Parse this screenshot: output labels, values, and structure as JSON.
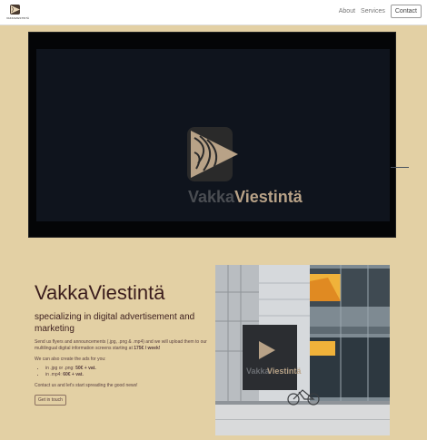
{
  "brand": {
    "tag": "VAKKAVIESTINTÄ"
  },
  "nav": {
    "about": "About",
    "services": "Services",
    "contact": "Contact"
  },
  "video": {
    "word_dark": "Vakka",
    "word_light": "Viestintä"
  },
  "hero": {
    "title": "VakkaViestintä",
    "subtitle": "specializing in digital advertisement and marketing",
    "intro_before_price": "Send us flyers and announcements (.jpg, .png & .mp4) and we will upload them to our multilingual digital information screens starting at ",
    "intro_price": "175€ / week!",
    "ads_intro": "We can also create the ads for you:",
    "ad_items": [
      {
        "label": "in .jpg or .png: ",
        "price": "50€ + vat."
      },
      {
        "label": "in .mp4: ",
        "price": "60€ + vat."
      }
    ],
    "contact_text": "Contact us and let's start spreading the good news!",
    "cta": "Get in touch"
  },
  "photo": {
    "sign_word_dark": "Vakka",
    "sign_word_light": "Viestintä"
  },
  "colors": {
    "background": "#e3d0a4",
    "navbar": "#ffffff",
    "title": "#3b1d1d",
    "logo_tan": "#b8a287"
  }
}
